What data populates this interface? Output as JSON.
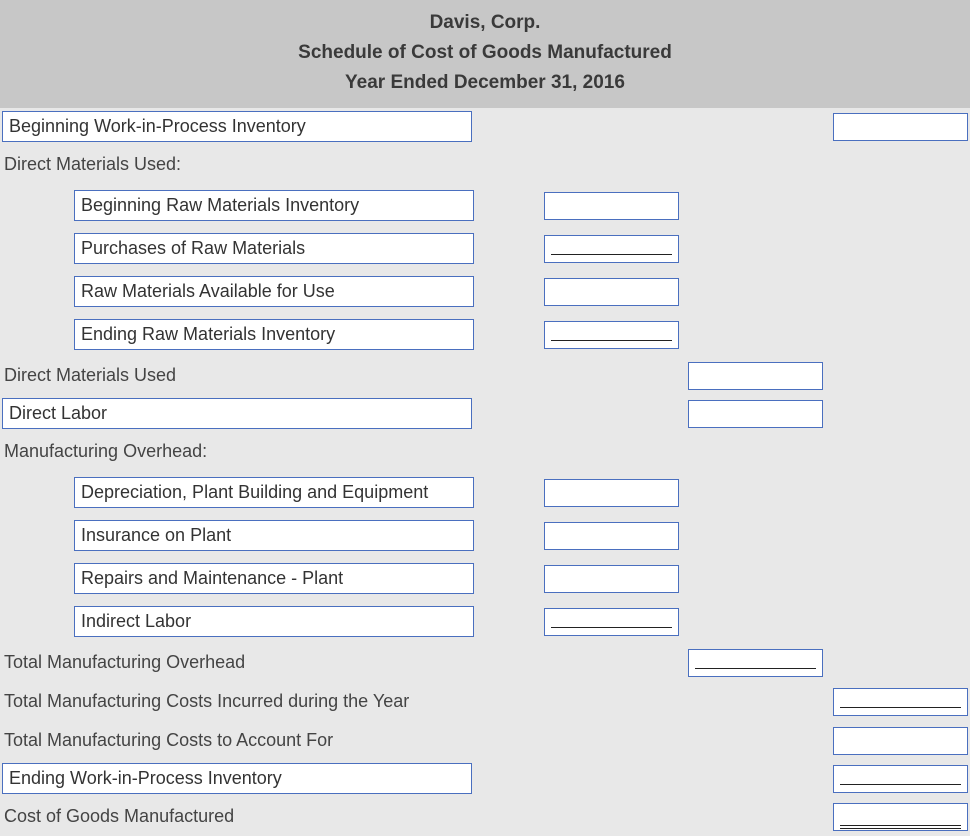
{
  "header": {
    "company": "Davis, Corp.",
    "title": "Schedule of Cost of Goods Manufactured",
    "period": "Year Ended December 31, 2016"
  },
  "rows": {
    "begin_wip": "Beginning Work-in-Process Inventory",
    "dm_used_header": "Direct Materials Used:",
    "begin_rm": "Beginning Raw Materials Inventory",
    "purchases_rm": "Purchases of Raw Materials",
    "rm_avail": "Raw Materials Available for Use",
    "end_rm": "Ending Raw Materials Inventory",
    "dm_used": "Direct Materials Used",
    "direct_labor": "Direct Labor",
    "moh_header": "Manufacturing Overhead:",
    "depreciation": "Depreciation, Plant Building and Equipment",
    "insurance": "Insurance on Plant",
    "repairs": "Repairs and Maintenance - Plant",
    "indirect_labor": "Indirect Labor",
    "total_moh": "Total Manufacturing Overhead",
    "total_mfg_incurred": "Total Manufacturing Costs Incurred during the Year",
    "total_mfg_acct": "Total Manufacturing Costs to Account For",
    "end_wip": "Ending Work-in-Process Inventory",
    "cogm": "Cost of Goods Manufactured"
  }
}
